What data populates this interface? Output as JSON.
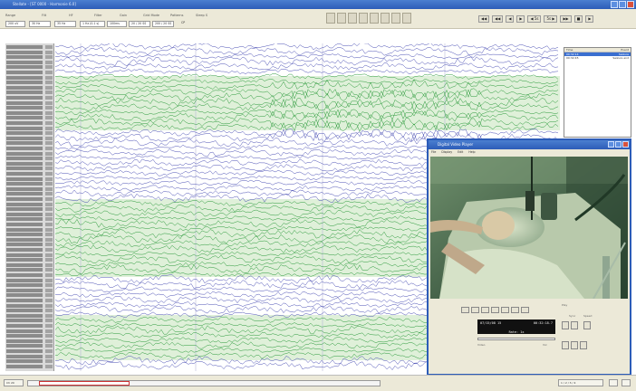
{
  "window": {
    "title": "Stellate - [ST 0000 - Harmonie 6.0]"
  },
  "toolbar": {
    "labels": [
      "Range",
      "Filt",
      "HF",
      "Filter",
      "Gain",
      "Grid Mode",
      "Patterns",
      "Sleep S"
    ],
    "combos": [
      "200 uV",
      "30 Hz",
      "35 Hz",
      "1 Hz (0.1 s)",
      "100ms",
      "20 / 20 SS",
      "200 / 20 SS"
    ],
    "combo_value_cp": "CP",
    "nav_buttons": [
      "◀◀",
      "◀◀",
      "◀",
      "▶",
      "◀ 5s",
      "5s ▶",
      "▶▶",
      "■",
      "▶"
    ]
  },
  "events_panel": {
    "col_time": "Time",
    "col_event": "Event",
    "rows": [
      {
        "time": "00:32:14",
        "event": "Seizure"
      },
      {
        "time": "00:32:45",
        "event": "Seizure end"
      }
    ]
  },
  "video": {
    "title": "Digital Video Player",
    "menu": [
      "File",
      "Display",
      "Edit",
      "Help"
    ],
    "time_left": "07/15/08 15",
    "time_right": "00:32:18.7",
    "time_sub": "Rate: 1x",
    "labels": {
      "play": "Play",
      "sync": "Sync",
      "speed": "Speed",
      "video": "Video",
      "vol": "Vol"
    }
  },
  "statusbar": {
    "left": "Ch 20",
    "right": "1 / 2 / 3 / 4"
  },
  "colors": {
    "accent": "#2c5cb8",
    "trace_blue": "#4a4fb4",
    "trace_green": "#2a9a3a",
    "band": "#dff0d9"
  }
}
